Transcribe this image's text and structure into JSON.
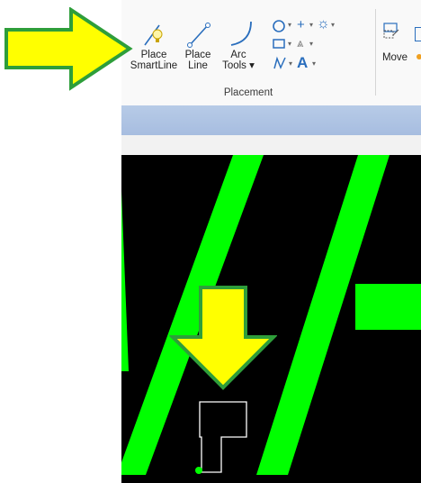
{
  "ribbon": {
    "tools": {
      "place_smartline": {
        "line1": "Place",
        "line2": "SmartLine"
      },
      "place_line": {
        "line1": "Place",
        "line2": "Line"
      },
      "arc_tools": {
        "line1": "Arc",
        "line2": "Tools"
      },
      "move": {
        "label": "Move"
      }
    },
    "group_label": "Placement"
  },
  "colors": {
    "accent_blue": "#2a6ebd",
    "highlight_green": "#00ff00",
    "arrow_yellow": "#ffff00",
    "arrow_border": "#2e9e3a",
    "canvas_bg": "#000000"
  },
  "icons": [
    "arrow-right-annotation-icon",
    "arrow-down-annotation-icon",
    "smartline-icon",
    "line-icon",
    "arc-icon",
    "circle-icon",
    "rectangle-icon",
    "plus-icon",
    "sun-icon",
    "text-icon",
    "move-icon"
  ]
}
